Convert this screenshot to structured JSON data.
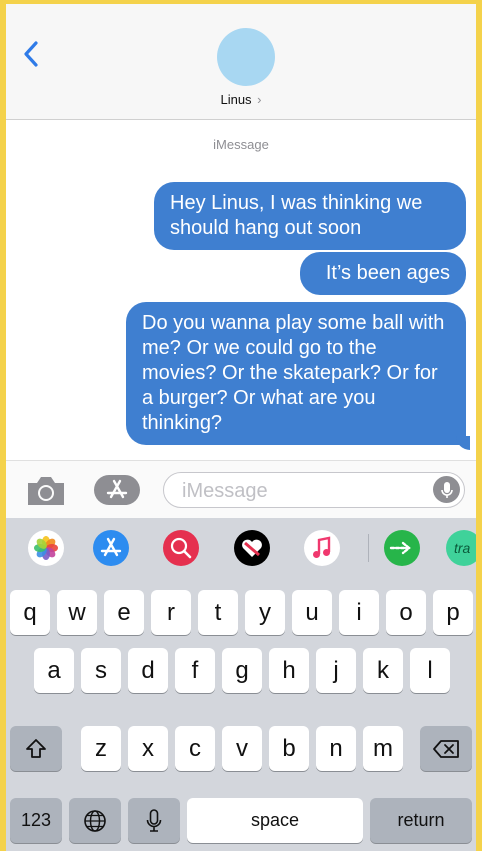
{
  "header": {
    "contact_name": "Linus",
    "contact_chevron": "›",
    "back_icon": "chevron-left-icon"
  },
  "conversation": {
    "service_label": "iMessage",
    "messages": [
      {
        "from": "me",
        "text": "Hey Linus, I was thinking we should hang out soon"
      },
      {
        "from": "me",
        "text": "It’s been ages"
      },
      {
        "from": "me",
        "text": "Do you wanna play some ball with me? Or we could go to the movies? Or the skatepark? Or for a burger? Or what are you thinking?"
      }
    ]
  },
  "input_bar": {
    "placeholder": "iMessage",
    "value": ""
  },
  "app_drawer": {
    "apps": [
      "photos-icon",
      "app-store-icon",
      "web-images-icon",
      "digital-touch-icon",
      "music-icon",
      "arrow-app-icon",
      "translate-app-icon"
    ],
    "partial_app_label": "tra"
  },
  "keyboard": {
    "row1": [
      "q",
      "w",
      "e",
      "r",
      "t",
      "y",
      "u",
      "i",
      "o",
      "p"
    ],
    "row2": [
      "a",
      "s",
      "d",
      "f",
      "g",
      "h",
      "j",
      "k",
      "l"
    ],
    "row3": [
      "z",
      "x",
      "c",
      "v",
      "b",
      "n",
      "m"
    ],
    "numbers_label": "123",
    "space_label": "space",
    "return_label": "return"
  },
  "colors": {
    "bubble": "#3f7fd0",
    "frame": "#f4d24b",
    "avatar": "#a8d7f2",
    "keyboard_bg": "#d3d6dc"
  }
}
